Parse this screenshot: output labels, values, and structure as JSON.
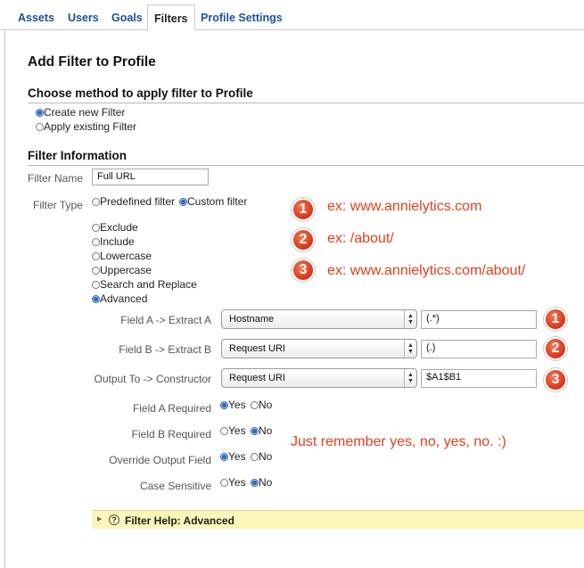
{
  "tabs": [
    {
      "label": "Assets"
    },
    {
      "label": "Users"
    },
    {
      "label": "Goals"
    },
    {
      "label": "Filters",
      "active": true
    },
    {
      "label": "Profile Settings"
    }
  ],
  "page_title": "Add Filter to Profile",
  "method_section": {
    "heading": "Choose method to apply filter to Profile",
    "options": [
      {
        "label": "Create new Filter",
        "checked": true
      },
      {
        "label": "Apply existing Filter",
        "checked": false
      }
    ]
  },
  "filter_info": {
    "heading": "Filter Information",
    "filter_name_label": "Filter Name",
    "filter_name_value": "Full URL",
    "filter_type_label": "Filter Type",
    "type_options": [
      {
        "label": "Predefined filter",
        "checked": false
      },
      {
        "label": "Custom filter",
        "checked": true
      }
    ],
    "custom_options": [
      {
        "label": "Exclude",
        "checked": false
      },
      {
        "label": "Include",
        "checked": false
      },
      {
        "label": "Lowercase",
        "checked": false
      },
      {
        "label": "Uppercase",
        "checked": false
      },
      {
        "label": "Search and Replace",
        "checked": false
      },
      {
        "label": "Advanced",
        "checked": true
      }
    ],
    "fields": [
      {
        "label": "Field A -> Extract A",
        "select": "Hostname",
        "text": "(.*)"
      },
      {
        "label": "Field B -> Extract B",
        "select": "Request URI",
        "text": "(.)"
      },
      {
        "label": "Output To -> Constructor",
        "select": "Request URI",
        "text": "$A1$B1"
      }
    ],
    "yes_no_rows": [
      {
        "label": "Field A Required",
        "yes": "Yes",
        "no": "No",
        "selected": "yes"
      },
      {
        "label": "Field B Required",
        "yes": "Yes",
        "no": "No",
        "selected": "no"
      },
      {
        "label": "Override Output Field",
        "yes": "Yes",
        "no": "No",
        "selected": "yes"
      },
      {
        "label": "Case Sensitive",
        "yes": "Yes",
        "no": "No",
        "selected": "no"
      }
    ]
  },
  "annotations": {
    "examples": [
      {
        "num": "1",
        "text": "ex: www.annielytics.com"
      },
      {
        "num": "2",
        "text": "ex: /about/"
      },
      {
        "num": "3",
        "text": "ex: www.annielytics.com/about/"
      }
    ],
    "field_badges": [
      "1",
      "2",
      "3"
    ],
    "remember": "Just remember yes, no, yes, no. :)"
  },
  "help_bar": {
    "label": "Filter Help: Advanced"
  },
  "colors": {
    "accent_link": "#1f4f9a",
    "annotation_red": "#e0401f",
    "help_yellow": "#faf6b8"
  }
}
